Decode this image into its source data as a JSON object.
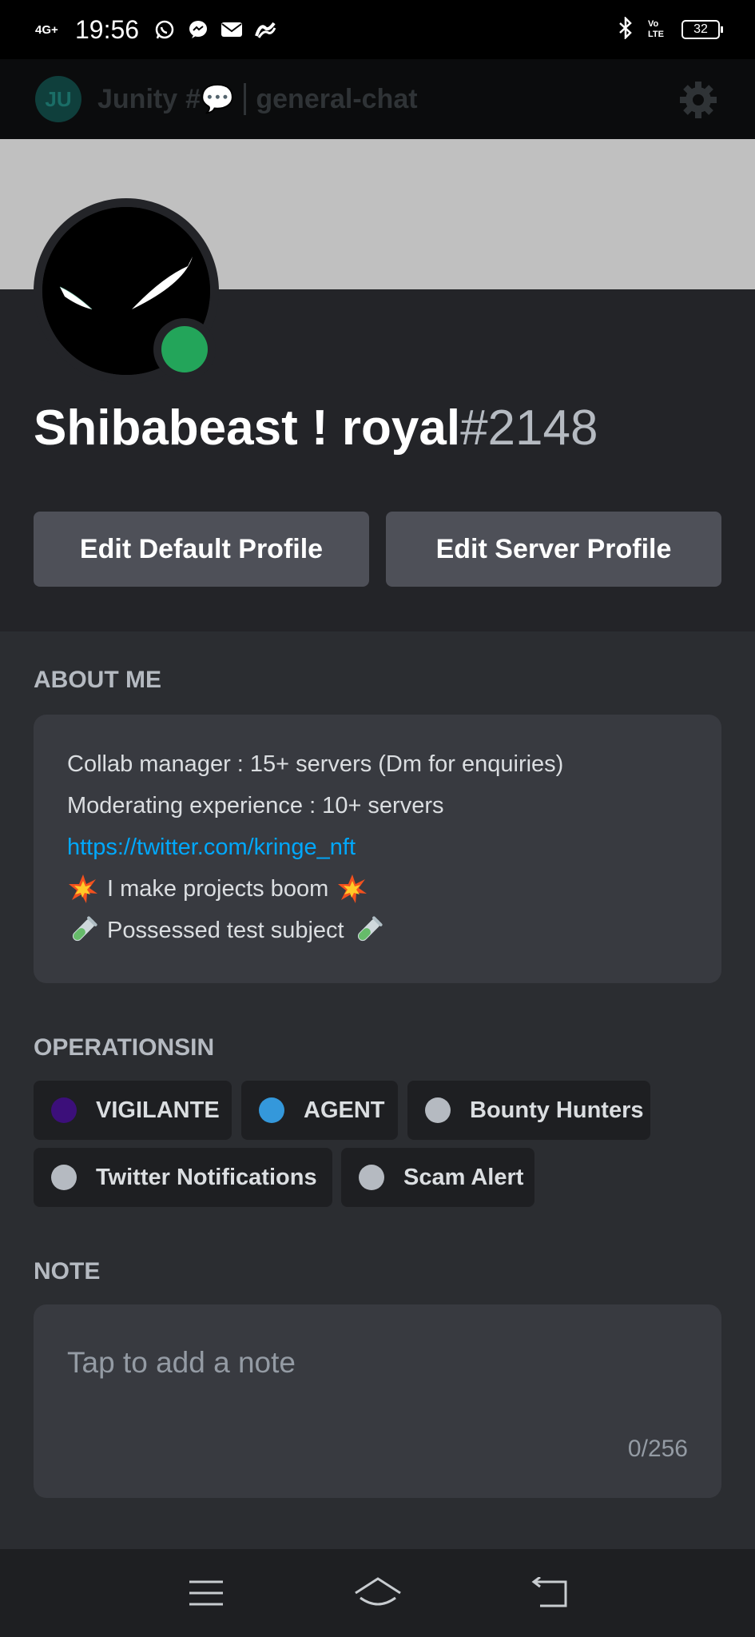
{
  "status_bar": {
    "network": "4G+",
    "time": "19:56",
    "battery": "32",
    "volte": "VoLTE",
    "left_icons": [
      "whatsapp-icon",
      "messenger-icon",
      "mail-icon",
      "app-icon"
    ],
    "right_icons": [
      "bluetooth-icon",
      "volte-icon",
      "battery-icon"
    ]
  },
  "channel_header": {
    "server_initials": "JU",
    "server": "Junity",
    "prefix": "#💬",
    "channel": "general-chat"
  },
  "profile": {
    "name": "Shibabeast ! royal",
    "discriminator": "#2148",
    "status_color": "#23a55a",
    "buttons": {
      "edit_default": "Edit Default Profile",
      "edit_server": "Edit Server Profile"
    }
  },
  "about": {
    "title": "ABOUT ME",
    "line1": "Collab manager : 15+ servers (Dm for enquiries)",
    "line2": "Moderating experience : 10+ servers",
    "link": "https://twitter.com/kringe_nft",
    "line4": "I make projects boom",
    "line5": "Possessed test subject"
  },
  "roles": {
    "title": "OPERATIONSIN",
    "items": [
      {
        "label": "VIGILANTE",
        "color": "#3c0f7a"
      },
      {
        "label": "AGENT",
        "color": "#3498db"
      },
      {
        "label": "Bounty Hunters",
        "color": "#b5bac1"
      },
      {
        "label": "Twitter Notifications",
        "color": "#b5bac1"
      },
      {
        "label": "Scam Alert",
        "color": "#b5bac1"
      }
    ]
  },
  "note": {
    "title": "NOTE",
    "placeholder": "Tap to add a note",
    "counter": "0/256"
  },
  "nav": {
    "icons": [
      "menu-icon",
      "home-icon",
      "back-icon"
    ]
  }
}
